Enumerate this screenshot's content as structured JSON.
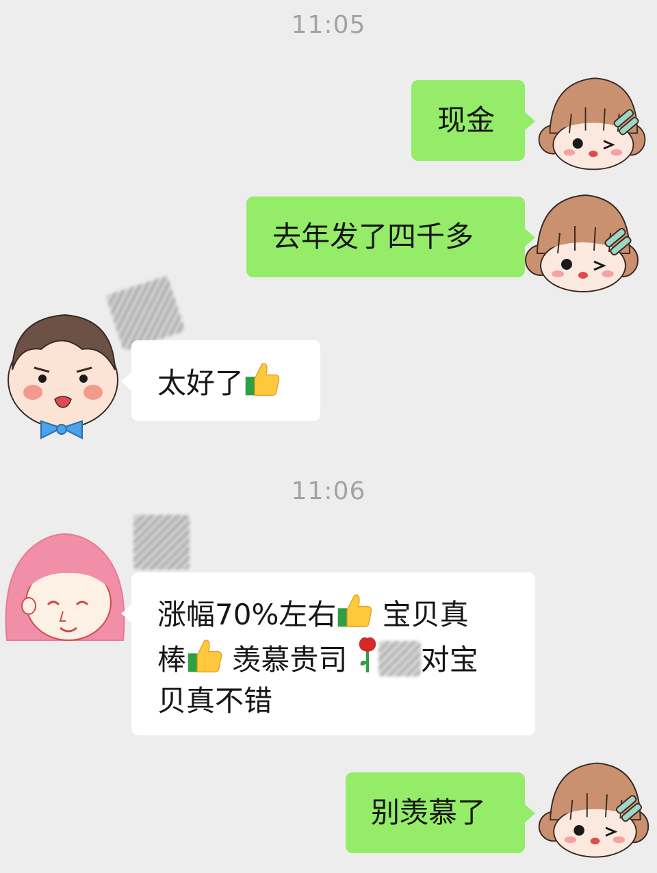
{
  "chat": {
    "timestamp_1": "11:05",
    "timestamp_2": "11:06",
    "messages": [
      {
        "sender": "me",
        "text": "现金"
      },
      {
        "sender": "me",
        "text": "去年发了四千多"
      },
      {
        "sender": "them",
        "text": "太好了"
      },
      {
        "sender": "them",
        "line1_a": "涨幅70%左右",
        "line1_b": " 宝贝真",
        "line2_a": "棒",
        "line2_b": " 羡慕贵司 ",
        "line2_c": "对宝",
        "line3": "贝真不错"
      },
      {
        "sender": "me",
        "text": "别羡慕了"
      }
    ]
  },
  "icons": {
    "thumbs_up": "thumbs-up-icon",
    "rose": "rose-icon",
    "avatar_me": "girl-with-hairclip-avatar",
    "avatar_boy": "boy-with-bowtie-avatar",
    "avatar_pink": "pink-hair-girl-avatar"
  },
  "colors": {
    "background": "#ededed",
    "my_bubble": "#95ec69",
    "their_bubble": "#ffffff",
    "timestamp": "#a3a3a3"
  }
}
